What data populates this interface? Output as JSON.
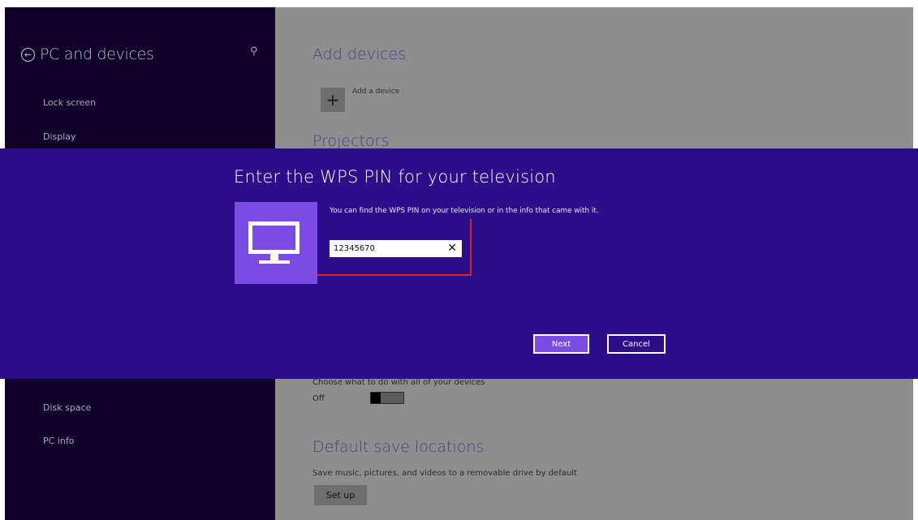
{
  "sidebar": {
    "title": "PC and devices",
    "back_icon": "back-arrow-icon",
    "search_icon": "search-icon",
    "items": [
      {
        "label": "Lock screen"
      },
      {
        "label": "Display"
      },
      {
        "label": "Disk space"
      },
      {
        "label": "PC info"
      }
    ]
  },
  "main": {
    "add_devices_heading": "Add devices",
    "add_device_label": "Add a device",
    "projectors_heading": "Projectors",
    "autoplay_desc": "Choose what to do with all of your devices",
    "toggle_state_label": "Off",
    "default_save_heading": "Default save locations",
    "default_save_desc": "Save music, pictures, and videos to a removable drive by default",
    "setup_label": "Set up"
  },
  "dialog": {
    "title": "Enter the WPS PIN for your television",
    "description": "You can find the WPS PIN on your television or in the info that came with it.",
    "pin_value": "12345670",
    "next_label": "Next",
    "cancel_label": "Cancel",
    "device_icon": "monitor-icon",
    "colors": {
      "dialog_bg": "#2c0d8a",
      "accent": "#7c4be6",
      "highlight": "#e01f1f"
    }
  }
}
